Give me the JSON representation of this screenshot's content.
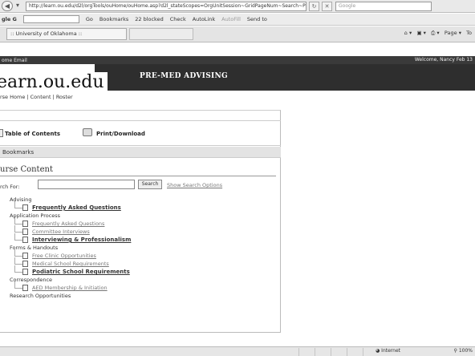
{
  "address_bar": {
    "url": "http://learn.ou.edu/d2l/orgTools/ouHome/ouHome.asp?d2l_stateScopes=OrgUnitSession~GridPageNum~Search~PageNum",
    "search_placeholder": "Google"
  },
  "google_toolbar": {
    "logo": "gle G",
    "go": "Go",
    "bookmarks": "Bookmarks",
    "blocked": "22 blocked",
    "check": "Check",
    "autolink": "AutoLink",
    "autofill": "AutoFill",
    "send_to": "Send to"
  },
  "tab": {
    "label": ":: University of Oklahoma ::"
  },
  "ie_tools": {
    "page": "Page",
    "tools": "To"
  },
  "top_nav": {
    "links": "ome  Email",
    "welcome": "Welcome, Nancy  Feb 13"
  },
  "banner": {
    "site_title": "earn.ou.edu",
    "label": "PRE-MED ADVISING"
  },
  "breadcrumbs": "rse Home | Content | Roster",
  "content_tools": {
    "toc": "Table of Contents",
    "print": "Print/Download"
  },
  "bookmarks_bar": "Bookmarks",
  "course_content": {
    "heading": "urse Content",
    "search_label": "rch For:",
    "search_button": "Search",
    "search_options": "Show Search Options"
  },
  "tree": [
    {
      "label": "Advising",
      "level": 1,
      "style": "plain"
    },
    {
      "label": "Frequently Asked Questions",
      "level": 2,
      "style": "bold"
    },
    {
      "label": "Application Process",
      "level": 1,
      "style": "plain"
    },
    {
      "label": "Frequently Asked Questions",
      "level": 2,
      "style": "faint"
    },
    {
      "label": "Committee Interviews",
      "level": 2,
      "style": "faint"
    },
    {
      "label": "Interviewing & Professionalism",
      "level": 2,
      "style": "bold"
    },
    {
      "label": "Forms & Handouts",
      "level": 1,
      "style": "plain"
    },
    {
      "label": "Free Clinic Opportunities",
      "level": 2,
      "style": "faint"
    },
    {
      "label": "Medical School Requirements",
      "level": 2,
      "style": "faint"
    },
    {
      "label": "Podiatric School Requirements",
      "level": 2,
      "style": "bold"
    },
    {
      "label": "Correspondence",
      "level": 1,
      "style": "plain"
    },
    {
      "label": "AED Membership & Initiation",
      "level": 2,
      "style": "faint"
    },
    {
      "label": "Research Opportunities",
      "level": 1,
      "style": "plain"
    }
  ],
  "status_bar": {
    "zone": "Internet",
    "zoom": "100%"
  }
}
